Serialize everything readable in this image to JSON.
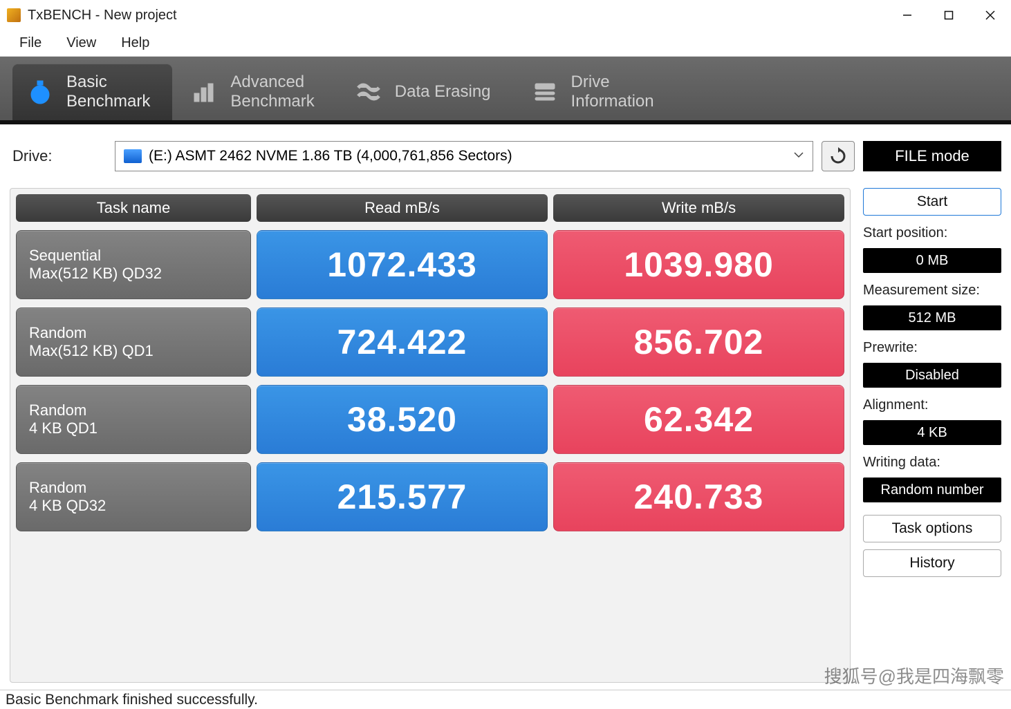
{
  "window": {
    "title": "TxBENCH - New project"
  },
  "menu": {
    "file": "File",
    "view": "View",
    "help": "Help"
  },
  "tabs": {
    "basic": {
      "l1": "Basic",
      "l2": "Benchmark"
    },
    "advanced": {
      "l1": "Advanced",
      "l2": "Benchmark"
    },
    "erase": {
      "l1": "Data Erasing",
      "l2": ""
    },
    "drive": {
      "l1": "Drive",
      "l2": "Information"
    }
  },
  "drive": {
    "label": "Drive:",
    "value": "(E:) ASMT 2462 NVME  1.86 TB (4,000,761,856 Sectors)"
  },
  "mode_button": "FILE mode",
  "headers": {
    "task": "Task name",
    "read": "Read mB/s",
    "write": "Write mB/s"
  },
  "rows": [
    {
      "t1": "Sequential",
      "t2": "Max(512 KB) QD32",
      "read": "1072.433",
      "write": "1039.980"
    },
    {
      "t1": "Random",
      "t2": "Max(512 KB) QD1",
      "read": "724.422",
      "write": "856.702"
    },
    {
      "t1": "Random",
      "t2": "4 KB QD1",
      "read": "38.520",
      "write": "62.342"
    },
    {
      "t1": "Random",
      "t2": "4 KB QD32",
      "read": "215.577",
      "write": "240.733"
    }
  ],
  "sidebar": {
    "start": "Start",
    "start_pos_label": "Start position:",
    "start_pos_value": "0 MB",
    "meas_size_label": "Measurement size:",
    "meas_size_value": "512 MB",
    "prewrite_label": "Prewrite:",
    "prewrite_value": "Disabled",
    "alignment_label": "Alignment:",
    "alignment_value": "4 KB",
    "writing_label": "Writing data:",
    "writing_value": "Random number",
    "task_options": "Task options",
    "history": "History"
  },
  "status": "Basic Benchmark finished successfully.",
  "watermark": "搜狐号@我是四海飘零"
}
